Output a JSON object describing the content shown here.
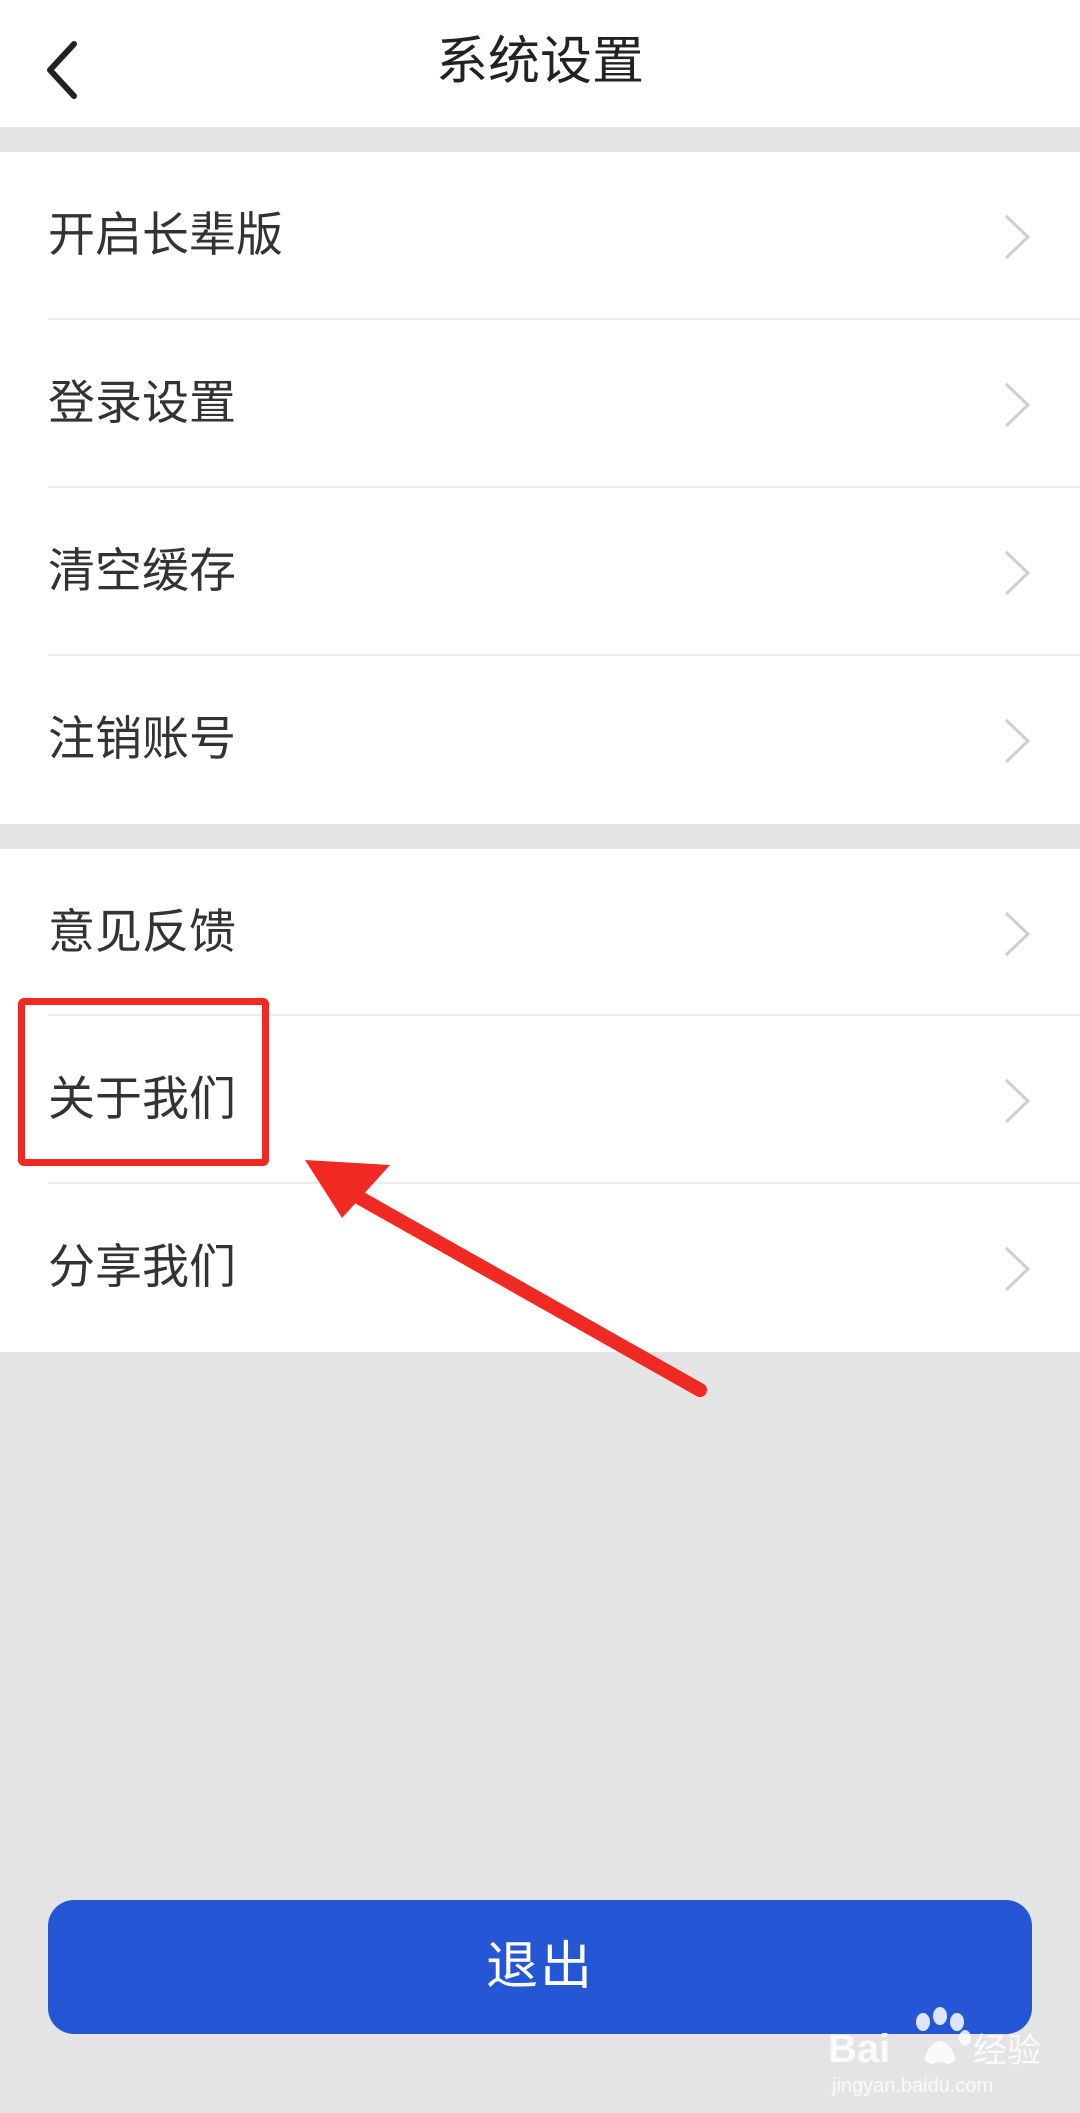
{
  "header": {
    "title": "系统设置",
    "back_icon": "chevron-left-icon"
  },
  "groups": [
    {
      "items": [
        {
          "label": "开启长辈版"
        },
        {
          "label": "登录设置"
        },
        {
          "label": "清空缓存"
        },
        {
          "label": "注销账号"
        }
      ]
    },
    {
      "items": [
        {
          "label": "意见反馈"
        },
        {
          "label": "关于我们"
        },
        {
          "label": "分享我们"
        }
      ]
    }
  ],
  "logout": {
    "label": "退出"
  },
  "annotation": {
    "highlight_color": "#f02a22"
  },
  "colors": {
    "accent": "#2456d6",
    "background": "#e4e4e4"
  },
  "watermark": {
    "brand": "Baidu经验",
    "url": "jingyan.baidu.com"
  }
}
